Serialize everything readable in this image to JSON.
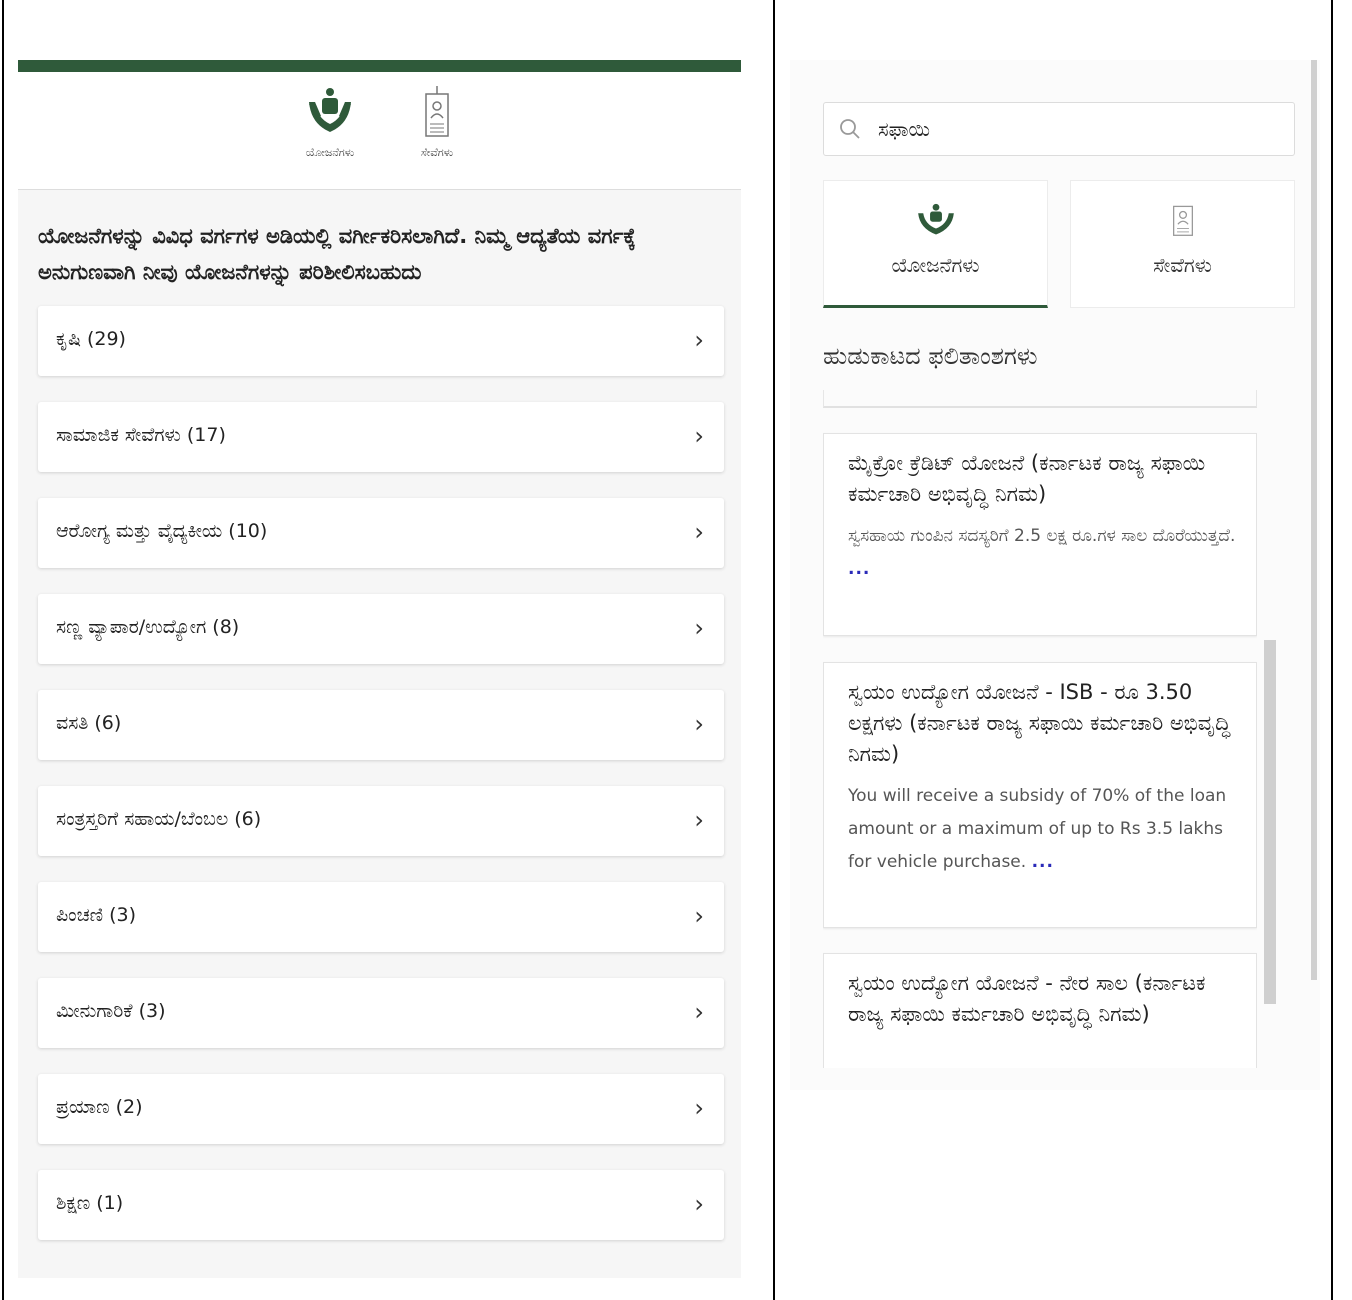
{
  "left_panel": {
    "header_tabs": [
      {
        "label": "ಯೋಜನೆಗಳು",
        "icon": "hands-people-icon"
      },
      {
        "label": "ಸೇವೆಗಳು",
        "icon": "id-card-icon"
      }
    ],
    "intro": "ಯೋಜನೆಗಳನ್ನು ವಿವಿಧ ವರ್ಗಗಳ ಅಡಿಯಲ್ಲಿ ವರ್ಗೀಕರಿಸಲಾಗಿದೆ. ನಿಮ್ಮ ಆದ್ಯತೆಯ ವರ್ಗಕ್ಕೆ ಅನುಗುಣವಾಗಿ ನೀವು ಯೋಜನೆಗಳನ್ನು ಪರಿಶೀಲಿಸಬಹುದು",
    "categories": [
      "ಕೃಷಿ (29)",
      "ಸಾಮಾಜಿಕ ಸೇವೆಗಳು (17)",
      "ಆರೋಗ್ಯ ಮತ್ತು ವೈದ್ಯಕೀಯ (10)",
      "ಸಣ್ಣ ವ್ಯಾಪಾರ/ಉದ್ಯೋಗ (8)",
      "ವಸತಿ (6)",
      "ಸಂತ್ರಸ್ತರಿಗೆ ಸಹಾಯ/ಬೆಂಬಲ (6)",
      "ಪಿಂಚಣಿ (3)",
      "ಮೀನುಗಾರಿಕೆ (3)",
      "ಪ್ರಯಾಣ (2)",
      "ಶಿಕ್ಷಣ (1)"
    ],
    "chevron": "›"
  },
  "right_panel": {
    "search": {
      "value": "ಸಫಾಯಿ",
      "icon": "search-icon"
    },
    "tabs": [
      {
        "label": "ಯೋಜನೆಗಳು",
        "icon": "hands-people-icon",
        "active": true
      },
      {
        "label": "ಸೇವೆಗಳು",
        "icon": "id-card-icon",
        "active": false
      }
    ],
    "results_title": "ಹುಡುಕಾಟದ ಫಲಿತಾಂಶಗಳು",
    "results": [
      {
        "title": "ಮೈಕ್ರೋ ಕ್ರೆಡಿಟ್ ಯೋಜನೆ (ಕರ್ನಾಟಕ ರಾಜ್ಯ ಸಫಾಯಿ ಕರ್ಮಚಾರಿ ಅಭಿವೃದ್ಧಿ ನಿಗಮ)",
        "desc": "ಸ್ವಸಹಾಯ ಗುಂಪಿನ ಸದಸ್ಯರಿಗೆ 2.5 ಲಕ್ಷ ರೂ.ಗಳ ಸಾಲ ದೊರೆಯುತ್ತದೆ.",
        "more": "..."
      },
      {
        "title": "ಸ್ವಯಂ ಉದ್ಯೋಗ ಯೋಜನೆ - ISB - ರೂ 3.50 ಲಕ್ಷಗಳು (ಕರ್ನಾಟಕ ರಾಜ್ಯ ಸಫಾಯಿ ಕರ್ಮಚಾರಿ ಅಭಿವೃದ್ಧಿ ನಿಗಮ)",
        "desc": "You will receive a subsidy of 70% of the loan amount or a maximum of up to Rs 3.5 lakhs for vehicle purchase.",
        "more": "..."
      },
      {
        "title": "ಸ್ವಯಂ ಉದ್ಯೋಗ ಯೋಜನೆ - ನೇರ ಸಾಲ (ಕರ್ನಾಟಕ ರಾಜ್ಯ ಸಫಾಯಿ ಕರ್ಮಚಾರಿ ಅಭಿವೃದ್ಧಿ ನಿಗಮ)",
        "desc": "",
        "more": ""
      }
    ]
  },
  "colors": {
    "brand_green": "#2f5a3a",
    "link_blue": "#2a2ab8"
  }
}
